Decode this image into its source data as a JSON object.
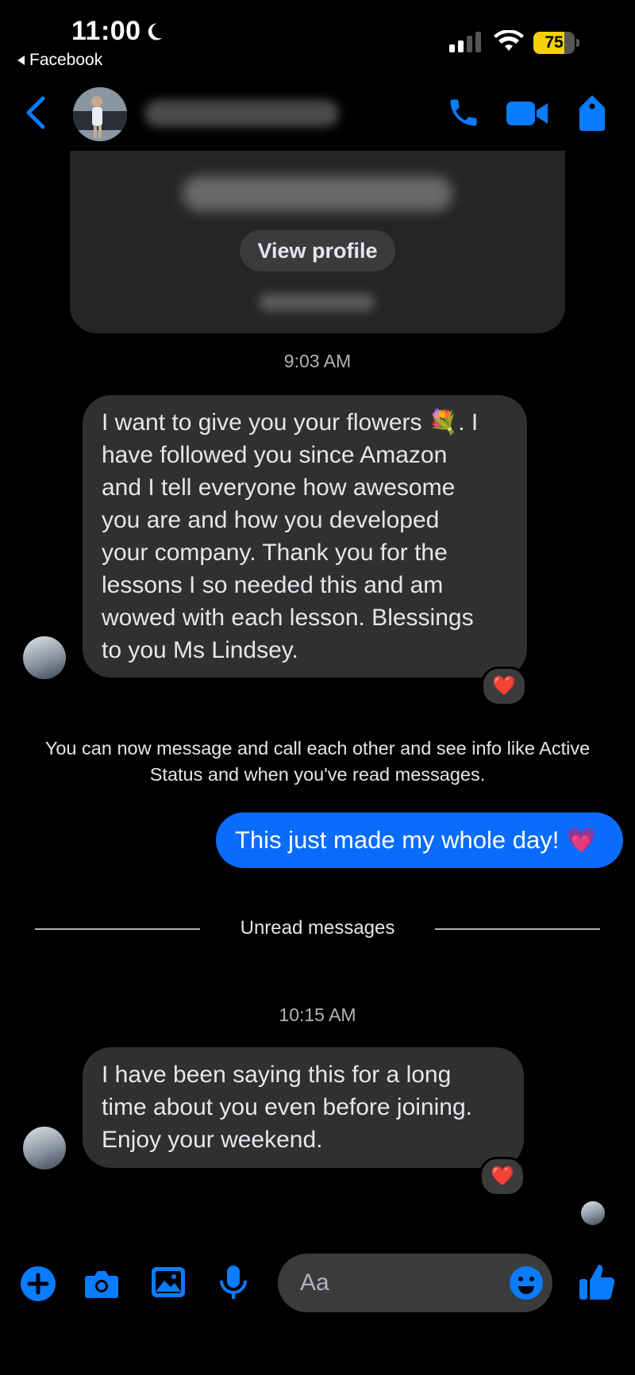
{
  "status_bar": {
    "time": "11:00",
    "back_app": "Facebook",
    "battery_level": 75,
    "battery_text": "75"
  },
  "header": {
    "contact_name": "",
    "icons": [
      "back-chevron-icon",
      "phone-icon",
      "video-icon",
      "tag-icon"
    ],
    "accent": "#0a7cff"
  },
  "profile_card": {
    "view_profile_label": "View profile"
  },
  "messages": {
    "timestamp_1": "9:03 AM",
    "incoming_1": {
      "lines": [
        "I want to give you your flowers 💐.  I",
        "have followed you since Amazon",
        "and I tell everyone how awesome",
        "you are and how you developed",
        "your company.  Thank you for the",
        "lessons I so needed this and am",
        "wowed with each lesson.  Blessings",
        "to you Ms Lindsey."
      ],
      "reaction": "❤️"
    },
    "system_message": {
      "line1": "You can now message and call each other and see info like Active",
      "line2": "Status and when you've read messages."
    },
    "outgoing_1": "This just made my whole day! 💗",
    "unread_label": "Unread messages",
    "timestamp_2": "10:15 AM",
    "incoming_2": {
      "lines": [
        "I have been saying this for a long",
        "time about you even before joining.",
        "Enjoy your weekend."
      ],
      "reaction": "❤️"
    }
  },
  "composer": {
    "placeholder": "Aa",
    "icons": [
      "plus-icon",
      "camera-icon",
      "gallery-icon",
      "microphone-icon",
      "emoji-icon",
      "thumbs-up-icon"
    ]
  },
  "colors": {
    "background": "#000000",
    "incoming_bubble": "#303030",
    "outgoing_bubble": "#0a6cff",
    "accent": "#0a7cff"
  }
}
